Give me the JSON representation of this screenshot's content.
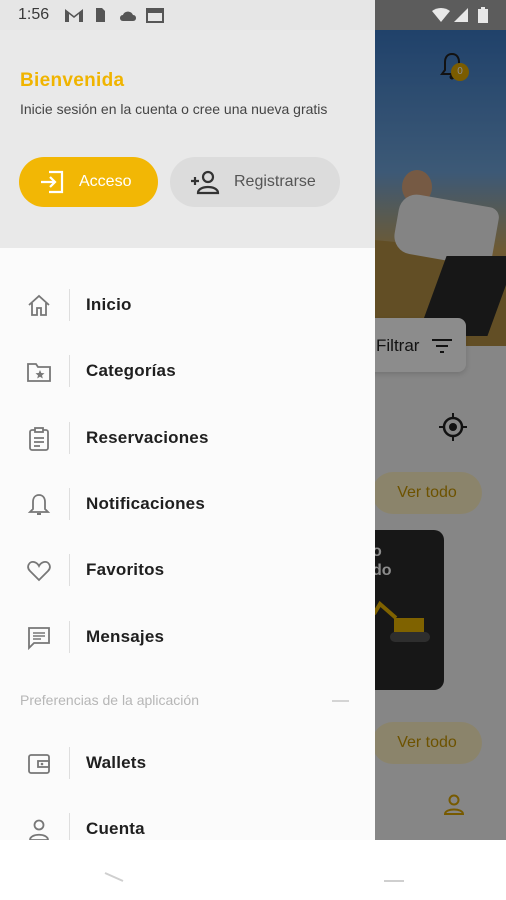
{
  "status_bar": {
    "time": "1:56",
    "icons": [
      "gmail-icon",
      "sim-icon",
      "cloud-icon",
      "calendar-icon",
      "wifi-icon",
      "signal-icon",
      "battery-icon"
    ]
  },
  "background": {
    "notification_count": "0",
    "filter_label": "Filtrar",
    "card_text_line1": "o",
    "card_text_line2": "do",
    "see_all_1": "Ver todo",
    "see_all_2": "Ver todo"
  },
  "drawer": {
    "header": {
      "title": "Bienvenida",
      "subtitle": "Inicie sesión en la cuenta o cree una nueva gratis",
      "login_label": "Acceso",
      "register_label": "Registrarse"
    },
    "menu": [
      {
        "label": "Inicio",
        "icon": "home-icon"
      },
      {
        "label": "Categorías",
        "icon": "folder-star-icon"
      },
      {
        "label": "Reservaciones",
        "icon": "clipboard-icon"
      },
      {
        "label": "Notificaciones",
        "icon": "bell-icon"
      },
      {
        "label": "Favoritos",
        "icon": "heart-icon"
      },
      {
        "label": "Mensajes",
        "icon": "message-icon"
      }
    ],
    "preferences_title": "Preferencias de la aplicación",
    "preferences": [
      {
        "label": "Wallets",
        "icon": "wallet-icon"
      },
      {
        "label": "Cuenta",
        "icon": "person-icon"
      }
    ]
  },
  "colors": {
    "accent": "#f2b705",
    "header_bg": "#e9e9e9",
    "drawer_bg": "#fbfbfb"
  }
}
